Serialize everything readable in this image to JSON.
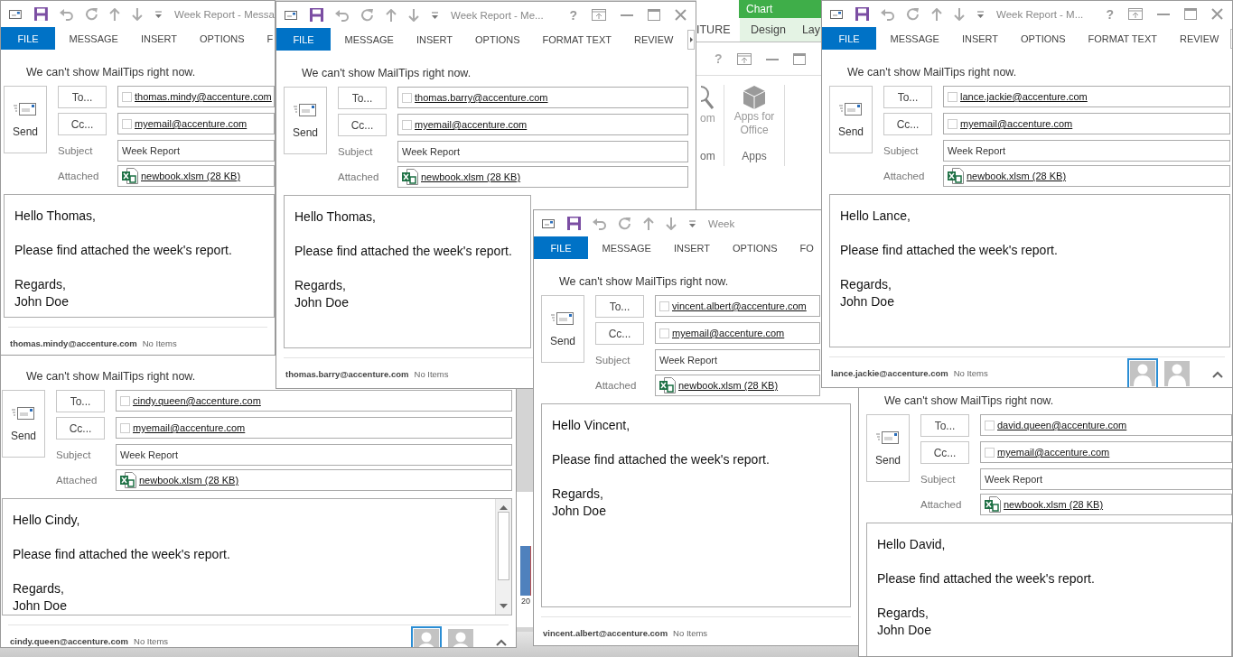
{
  "background_app": {
    "context_header": "Chart",
    "tabs": [
      "ITURE",
      "Design",
      "Lay"
    ],
    "help_button": "?",
    "commands": [
      "om",
      "Apps for Office"
    ],
    "group_labels": [
      "om",
      "Apps"
    ],
    "axis_label": "20"
  },
  "windows": [
    {
      "title": "Week Report - Messa",
      "tabs": [
        "FILE",
        "MESSAGE",
        "INSERT",
        "OPTIONS",
        "F"
      ],
      "mailtip": "We can't show MailTips right now.",
      "send_button": "Send",
      "to_button": "To...",
      "cc_button": "Cc...",
      "to": "thomas.mindy@accenture.com",
      "cc": "myemail@accenture.com",
      "subject_label": "Subject",
      "subject": "Week Report",
      "attached_label": "Attached",
      "attachment": "newbook.xlsm (28 KB)",
      "greeting": "Hello Thomas,",
      "message": "Please find attached the week's report.",
      "closing": "Regards,",
      "signature": "John Doe",
      "account": "thomas.mindy@accenture.com",
      "status": "No Items"
    },
    {
      "title": "Week Report - Me...",
      "help_button": "?",
      "tabs": [
        "FILE",
        "MESSAGE",
        "INSERT",
        "OPTIONS",
        "FORMAT TEXT",
        "REVIEW"
      ],
      "mailtip": "We can't show MailTips right now.",
      "send_button": "Send",
      "to_button": "To...",
      "cc_button": "Cc...",
      "to": "thomas.barry@accenture.com",
      "cc": "myemail@accenture.com",
      "subject_label": "Subject",
      "subject": "Week Report",
      "attached_label": "Attached",
      "attachment": "newbook.xlsm (28 KB)",
      "greeting": "Hello Thomas,",
      "message": "Please find attached the week's report.",
      "closing": "Regards,",
      "signature": "John Doe",
      "account": "thomas.barry@accenture.com",
      "status": "No Items"
    },
    {
      "mailtip": "We can't show MailTips right now.",
      "send_button": "Send",
      "to_button": "To...",
      "cc_button": "Cc...",
      "to": "cindy.queen@accenture.com",
      "cc": "myemail@accenture.com",
      "subject_label": "Subject",
      "subject": "Week Report",
      "attached_label": "Attached",
      "attachment": "newbook.xlsm (28 KB)",
      "greeting": "Hello Cindy,",
      "message": "Please find attached the week's report.",
      "closing": "Regards,",
      "signature": "John Doe",
      "scrollbar": true,
      "account": "cindy.queen@accenture.com",
      "status": "No Items",
      "people": [
        {
          "selected": true
        },
        {
          "selected": false
        }
      ]
    },
    {
      "title": "Week",
      "tabs": [
        "FILE",
        "MESSAGE",
        "INSERT",
        "OPTIONS",
        "FO"
      ],
      "mailtip": "We can't show MailTips right now.",
      "send_button": "Send",
      "to_button": "To...",
      "cc_button": "Cc...",
      "to": "vincent.albert@accenture.com",
      "cc": "myemail@accenture.com",
      "subject_label": "Subject",
      "subject": "Week Report",
      "attached_label": "Attached",
      "attachment": "newbook.xlsm (28 KB)",
      "greeting": "Hello Vincent,",
      "message": "Please find attached the week's report.",
      "closing": "Regards,",
      "signature": "John Doe",
      "account": "vincent.albert@accenture.com",
      "status": "No Items"
    },
    {
      "title": "Week Report - M...",
      "help_button": "?",
      "tabs": [
        "FILE",
        "MESSAGE",
        "INSERT",
        "OPTIONS",
        "FORMAT TEXT",
        "REVIEW"
      ],
      "mailtip": "We can't show MailTips right now.",
      "send_button": "Send",
      "to_button": "To...",
      "cc_button": "Cc...",
      "to": "lance.jackie@accenture.com",
      "cc": "myemail@accenture.com",
      "subject_label": "Subject",
      "subject": "Week Report",
      "attached_label": "Attached",
      "attachment": "newbook.xlsm (28 KB)",
      "greeting": "Hello Lance,",
      "message": "Please find attached the week's report.",
      "closing": "Regards,",
      "signature": "John Doe",
      "account": "lance.jackie@accenture.com",
      "status": "No Items",
      "people": [
        {
          "selected": true
        },
        {
          "selected": false
        }
      ]
    },
    {
      "mailtip": "We can't show MailTips right now.",
      "send_button": "Send",
      "to_button": "To...",
      "cc_button": "Cc...",
      "to": "david.queen@accenture.com",
      "cc": "myemail@accenture.com",
      "subject_label": "Subject",
      "subject": "Week Report",
      "attached_label": "Attached",
      "attachment": "newbook.xlsm (28 KB)",
      "greeting": "Hello David,",
      "message": "Please find attached the week's report.",
      "closing": "Regards,",
      "signature": "John Doe"
    }
  ]
}
